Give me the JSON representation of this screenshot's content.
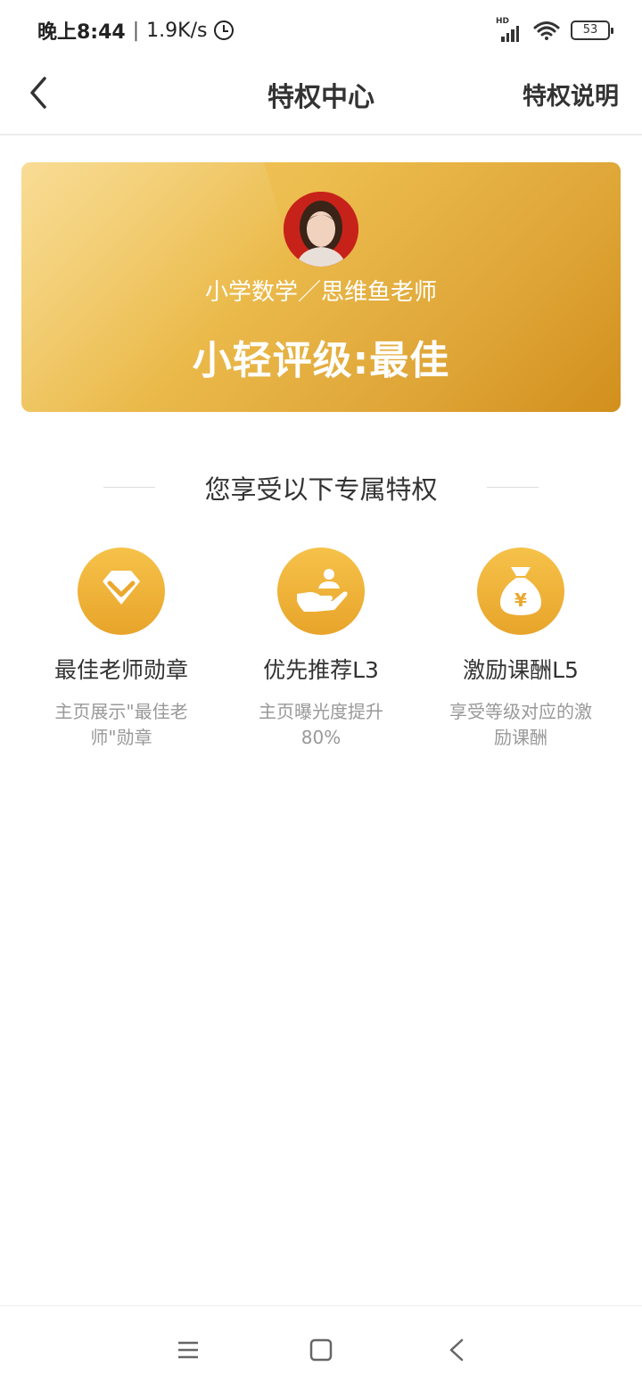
{
  "status_bar": {
    "time": "晚上8:44",
    "speed": "1.9K/s",
    "network": "HD",
    "battery": "53"
  },
  "header": {
    "title": "特权中心",
    "right_link": "特权说明"
  },
  "card": {
    "teacher_name": "小学数学／思维鱼老师",
    "rating": "小轻评级:最佳"
  },
  "section": {
    "title": "您享受以下专属特权"
  },
  "privileges": [
    {
      "icon": "diamond-badge-icon",
      "title": "最佳老师勋章",
      "desc": "主页展示\"最佳老师\"勋章"
    },
    {
      "icon": "hand-recommend-icon",
      "title": "优先推荐L3",
      "desc": "主页曝光度提升80%"
    },
    {
      "icon": "money-bag-icon",
      "title": "激励课酬L5",
      "desc": "享受等级对应的激励课酬"
    }
  ],
  "colors": {
    "gold_start": "#f6cf6c",
    "gold_end": "#d28f1c",
    "icon_gold": "#eba82e"
  }
}
